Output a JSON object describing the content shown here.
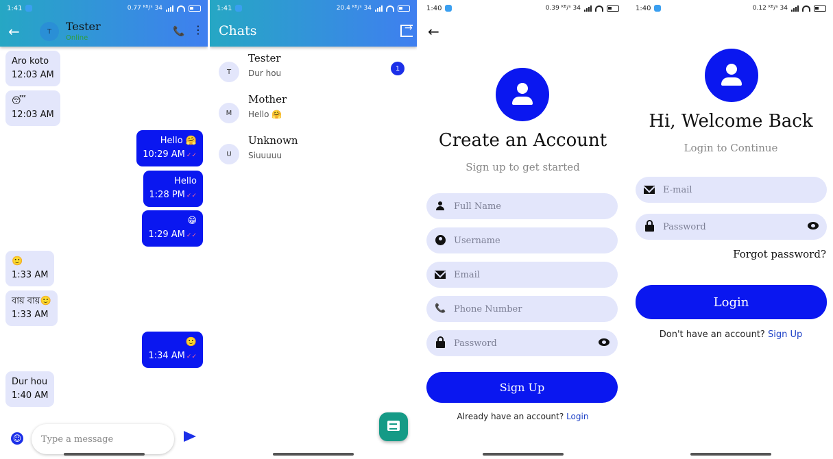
{
  "chat": {
    "status_time": "1:41",
    "status_right": "0.77 ᴷᴮ/ˢ 34",
    "contact_avatar": "T",
    "contact_name": "Tester",
    "contact_status": "Online",
    "messages": [
      {
        "dir": "in",
        "text": "Aro koto",
        "time": "12:03 AM"
      },
      {
        "dir": "in",
        "text": "😴",
        "time": "12:03 AM"
      },
      {
        "dir": "out",
        "text": "Hello 🤗",
        "time": "10:29 AM"
      },
      {
        "dir": "out",
        "text": "Hello",
        "time": "1:28 PM"
      },
      {
        "dir": "out",
        "text": "😁",
        "time": "1:29 AM"
      },
      {
        "dir": "in",
        "text": "🙂",
        "time": "1:33 AM"
      },
      {
        "dir": "in",
        "text": "বায় বায়🙂",
        "time": "1:33 AM"
      },
      {
        "dir": "out",
        "text": "🙂",
        "time": "1:34 AM"
      },
      {
        "dir": "in",
        "text": "Dur hou",
        "time": "1:40 AM"
      }
    ],
    "input_placeholder": "Type a message",
    "colors": {
      "incoming": "#e3e6fb",
      "outgoing": "#0a17f0",
      "online": "#2e9e3e"
    }
  },
  "chats": {
    "status_time": "1:41",
    "status_right": "20.4 ᴷᴮ/ˢ 34",
    "title": "Chats",
    "items": [
      {
        "avatar": "T",
        "name": "Tester",
        "preview": "Dur hou",
        "unread": "1"
      },
      {
        "avatar": "M",
        "name": "Mother",
        "preview": "Hello 🤗",
        "unread": ""
      },
      {
        "avatar": "U",
        "name": "Unknown",
        "preview": "Siuuuuu",
        "unread": ""
      }
    ]
  },
  "signup": {
    "status_time": "1:40",
    "status_right": "0.39 ᴷᴮ/ˢ 34",
    "title": "Create an Account",
    "subtitle": "Sign up to get started",
    "fields": {
      "full_name": "Full Name",
      "username": "Username",
      "email": "Email",
      "phone": "Phone Number",
      "password": "Password"
    },
    "button": "Sign Up",
    "footer_text": "Already have an account?",
    "footer_link": "Login"
  },
  "login": {
    "status_time": "1:40",
    "status_right": "0.12 ᴷᴮ/ˢ 34",
    "title": "Hi, Welcome Back",
    "subtitle": "Login to Continue",
    "fields": {
      "email": "E-mail",
      "password": "Password"
    },
    "forgot": "Forgot password?",
    "button": "Login",
    "footer_text": "Don't have an account?",
    "footer_link": "Sign Up"
  }
}
